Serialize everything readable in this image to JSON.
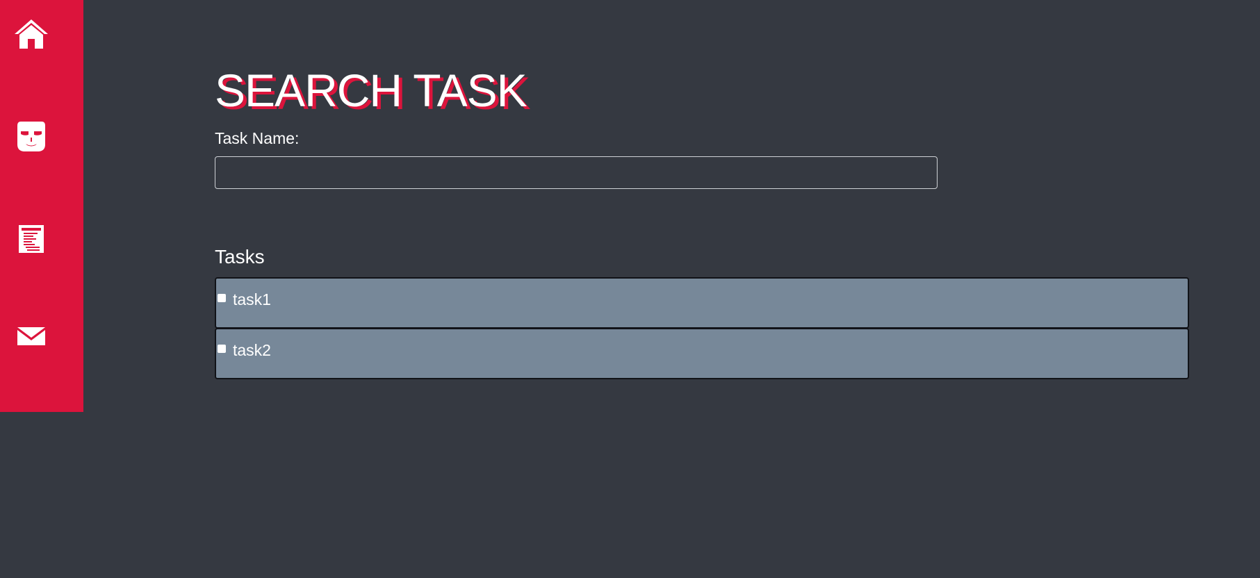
{
  "sidebar": {
    "color": "#dc143c",
    "items": [
      {
        "icon": "home-icon"
      },
      {
        "icon": "mask-icon"
      },
      {
        "icon": "document-icon"
      },
      {
        "icon": "mail-icon"
      }
    ]
  },
  "main": {
    "title": "SEARCH TASK",
    "field_label": "Task Name:",
    "search_value": "",
    "tasks_heading": "Tasks",
    "tasks": [
      {
        "name": "task1",
        "checked": false
      },
      {
        "name": "task2",
        "checked": false
      }
    ]
  },
  "colors": {
    "background": "#353941",
    "accent": "#dc143c",
    "task_row": "#778899"
  }
}
